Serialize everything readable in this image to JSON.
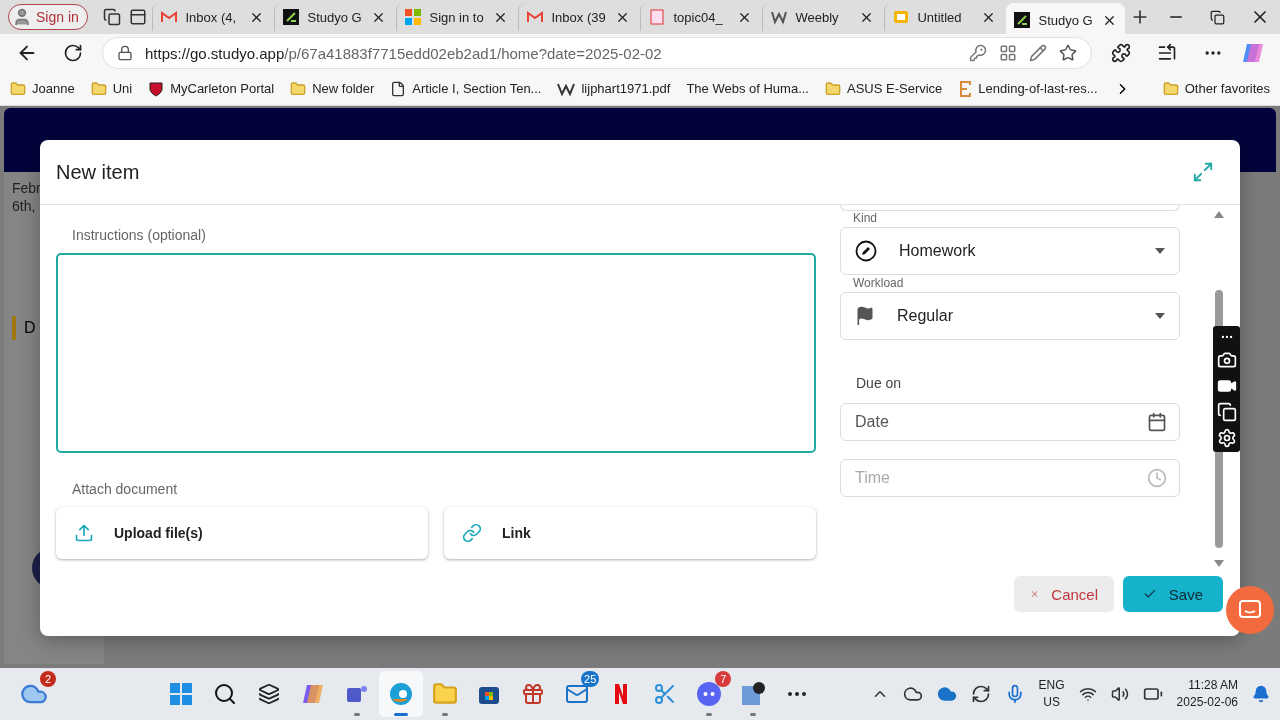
{
  "browser": {
    "sign_in": "Sign in",
    "tabs": [
      {
        "title": "Inbox (4,",
        "kind": "gmail",
        "selected": false
      },
      {
        "title": "Studyo G",
        "kind": "studyo",
        "selected": false
      },
      {
        "title": "Sign in to",
        "kind": "microsoft",
        "selected": false
      },
      {
        "title": "Inbox (39",
        "kind": "gmail",
        "selected": false
      },
      {
        "title": "topic04_",
        "kind": "pdf",
        "selected": false
      },
      {
        "title": "Weebly",
        "kind": "weebly",
        "selected": false
      },
      {
        "title": "Untitled",
        "kind": "slides",
        "selected": false
      },
      {
        "title": "Studyo G",
        "kind": "studyo",
        "selected": true
      }
    ],
    "url_host": "https://go.studyo.app",
    "url_path": "/p/67a41883f7715edd02eb2ad1/home?date=2025-02-02",
    "bookmarks": [
      {
        "label": "Joanne",
        "kind": "folder"
      },
      {
        "label": "Uni",
        "kind": "folder"
      },
      {
        "label": "MyCarleton Portal",
        "kind": "shield"
      },
      {
        "label": "New folder",
        "kind": "folder"
      },
      {
        "label": "Article I, Section Ten...",
        "kind": "page"
      },
      {
        "label": "lijphart1971.pdf",
        "kind": "weebly"
      },
      {
        "label": "The Webs of Huma...",
        "kind": "none"
      },
      {
        "label": "ASUS E-Service",
        "kind": "folder"
      },
      {
        "label": "Lending-of-last-res...",
        "kind": "letter"
      }
    ],
    "other_favorites": "Other favorites"
  },
  "app": {
    "date_lines": [
      "Febr",
      "6th,"
    ],
    "item": "D"
  },
  "dialog": {
    "title": "New item",
    "instructions_label": "Instructions (optional)",
    "attach_label": "Attach document",
    "attach_buttons": [
      {
        "label": "Upload file(s)",
        "kind": "upload"
      },
      {
        "label": "Link",
        "kind": "link"
      }
    ],
    "kind": {
      "label": "Kind",
      "value": "Homework"
    },
    "workload": {
      "label": "Workload",
      "value": "Regular"
    },
    "due_label": "Due on",
    "date_placeholder": "Date",
    "time_placeholder": "Time",
    "cancel": "Cancel",
    "save": "Save"
  },
  "taskbar": {
    "weather_badge": "2",
    "apps": [
      {
        "kind": "start",
        "active": false,
        "running": false
      },
      {
        "kind": "search",
        "active": false,
        "running": false
      },
      {
        "kind": "taskview",
        "active": false,
        "running": false
      },
      {
        "kind": "copilot",
        "active": false,
        "running": false
      },
      {
        "kind": "teams",
        "active": false,
        "running": true
      },
      {
        "kind": "edge",
        "active": true,
        "running": true
      },
      {
        "kind": "explorer",
        "active": false,
        "running": true
      },
      {
        "kind": "store",
        "active": false,
        "running": false
      },
      {
        "kind": "gift",
        "active": false,
        "running": false
      },
      {
        "kind": "mail",
        "active": false,
        "running": false,
        "badge": "25"
      },
      {
        "kind": "netflix",
        "active": false,
        "running": false
      },
      {
        "kind": "snip",
        "active": false,
        "running": false
      },
      {
        "kind": "discord",
        "active": false,
        "running": true,
        "badge": "7"
      },
      {
        "kind": "video",
        "active": false,
        "running": true
      },
      {
        "kind": "more",
        "active": false,
        "running": false
      }
    ],
    "language": "ENG",
    "region": "US",
    "time": "11:28 AM",
    "date": "2025-02-06"
  }
}
